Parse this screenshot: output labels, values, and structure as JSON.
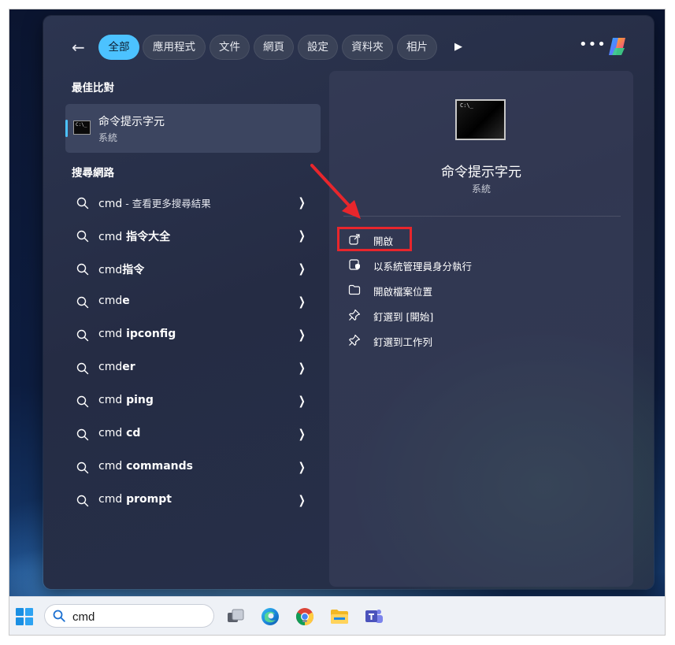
{
  "filter_bar": {
    "chips": [
      "全部",
      "應用程式",
      "文件",
      "網頁",
      "設定",
      "資料夾",
      "相片"
    ],
    "active_index": 0
  },
  "best_match": {
    "section_title": "最佳比對",
    "app_name": "命令提示字元",
    "app_type": "系統",
    "icon_text": "C:\\_"
  },
  "web_search": {
    "section_title": "搜尋網路",
    "items": [
      {
        "prefix": "cmd",
        "rest": "",
        "hint": " - 查看更多搜尋結果"
      },
      {
        "prefix": "cmd",
        "rest": " 指令大全",
        "hint": ""
      },
      {
        "prefix": "cmd",
        "rest": "指令",
        "hint": ""
      },
      {
        "prefix": "cmd",
        "rest": "e",
        "hint": ""
      },
      {
        "prefix": "cmd",
        "rest": " ipconfig",
        "hint": ""
      },
      {
        "prefix": "cmd",
        "rest": "er",
        "hint": ""
      },
      {
        "prefix": "cmd",
        "rest": " ping",
        "hint": ""
      },
      {
        "prefix": "cmd",
        "rest": " cd",
        "hint": ""
      },
      {
        "prefix": "cmd",
        "rest": " commands",
        "hint": ""
      },
      {
        "prefix": "cmd",
        "rest": " prompt",
        "hint": ""
      }
    ]
  },
  "preview": {
    "title": "命令提示字元",
    "subtitle": "系統",
    "icon_text": "C:\\_",
    "actions": [
      {
        "label": "開啟",
        "icon": "open-external-icon"
      },
      {
        "label": "以系統管理員身分執行",
        "icon": "run-as-admin-icon"
      },
      {
        "label": "開啟檔案位置",
        "icon": "folder-icon"
      },
      {
        "label": "釘選到 [開始]",
        "icon": "pin-icon"
      },
      {
        "label": "釘選到工作列",
        "icon": "pin-icon"
      }
    ]
  },
  "taskbar": {
    "search_value": "cmd",
    "apps": [
      "task-view-icon",
      "edge-icon",
      "chrome-icon",
      "file-explorer-icon",
      "teams-icon"
    ]
  },
  "colors": {
    "accent": "#4cc2ff",
    "highlight_box": "#e8262c",
    "annotation_arrow": "#e8262c"
  }
}
